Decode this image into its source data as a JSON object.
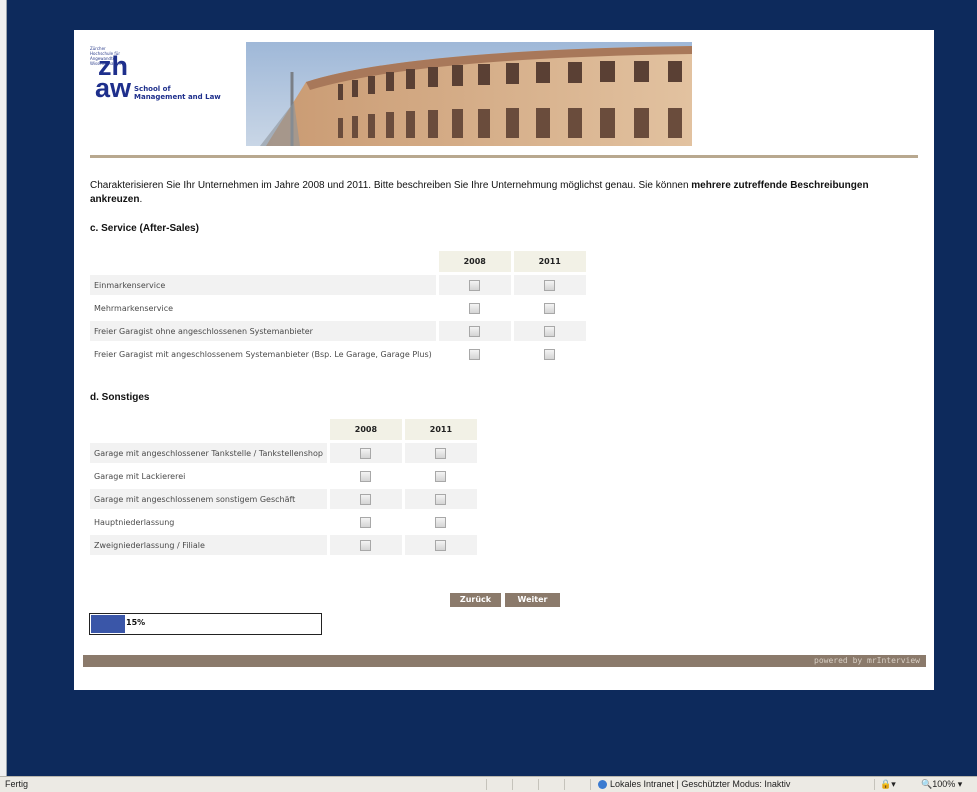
{
  "logo": {
    "tiny_text": "Zürcher Hochschule für Angewandte Wissenschaften",
    "mark_top": "zh",
    "mark_bottom": "aw",
    "school_line1": "School of",
    "school_line2": "Management and Law"
  },
  "intro": {
    "text": "Charakterisieren Sie Ihr Unternehmen im Jahre 2008 und 2011. Bitte beschreiben Sie Ihre Unternehmung möglichst genau. Sie können ",
    "bold": "mehrere zutreffende Beschreibungen ankreuzen",
    "end": "."
  },
  "section_c": {
    "title": "c. Service (After-Sales)",
    "col1": "2008",
    "col2": "2011",
    "rows": [
      "Einmarkenservice",
      "Mehrmarkenservice",
      "Freier Garagist ohne angeschlossenen Systemanbieter",
      "Freier Garagist mit angeschlossenem Systemanbieter (Bsp. Le Garage, Garage Plus)"
    ]
  },
  "section_d": {
    "title": "d. Sonstiges",
    "col1": "2008",
    "col2": "2011",
    "rows": [
      "Garage mit angeschlossener Tankstelle / Tankstellenshop",
      "Garage mit Lackiererei",
      "Garage mit angeschlossenem sonstigem Geschäft",
      "Hauptniederlassung",
      "Zweigniederlassung / Filiale"
    ]
  },
  "buttons": {
    "back": "Zurück",
    "next": "Weiter"
  },
  "progress": {
    "label": "15%",
    "value": 15
  },
  "footer": {
    "powered": "powered by mrInterview"
  },
  "statusbar": {
    "status": "Fertig",
    "zone": "Lokales Intranet | Geschützter Modus: Inaktiv",
    "zoom": "100%"
  },
  "colors": {
    "background": "#0d2a5c",
    "accent": "#8b7a6b",
    "progress": "#3a56a8",
    "rule": "#b8a88f"
  },
  "icons": [
    "globe-icon",
    "security-icon",
    "zoom-icon",
    "checkbox-icon"
  ]
}
